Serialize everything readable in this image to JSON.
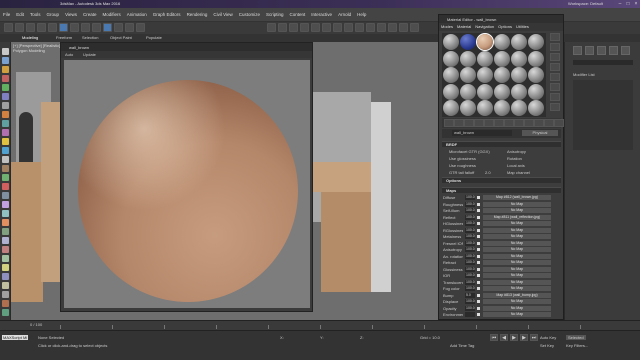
{
  "app": {
    "title": "3dsMax - Autodesk 3ds Max 2016",
    "workspace": "Workspace: Default"
  },
  "menubar": [
    "File",
    "Edit",
    "Tools",
    "Group",
    "Views",
    "Create",
    "Modifiers",
    "Animation",
    "Graph Editors",
    "Rendering",
    "Civil View",
    "Customize",
    "Scripting",
    "Content",
    "Interactive",
    "Arnold",
    "Help"
  ],
  "ribbon": {
    "tabs": [
      "Modeling",
      "Freeform",
      "Selection",
      "Object Paint",
      "Populate"
    ],
    "sublabel": "Polygon Modeling"
  },
  "viewport": {
    "label": "[+] [Perspective] [Realistic]"
  },
  "viewport_editor": {
    "title": "wall_brown",
    "auto_label": "Auto",
    "update_label": "Update"
  },
  "material_editor": {
    "title": "Material Editor - wall_brown",
    "menu": [
      "Modes",
      "Material",
      "Navigation",
      "Options",
      "Utilities"
    ],
    "material_name": "wall_brown",
    "material_type": "Physical",
    "sections": {
      "basic": "BRDF",
      "options": "Options",
      "maps": "Maps"
    },
    "brdf_rows": [
      {
        "label": "Microfacet GTR (GGX)",
        "value": "",
        "extra": "Anisotropy"
      },
      {
        "label": "Use glossiness",
        "value": "",
        "extra": "Rotation"
      },
      {
        "label": "Use roughness",
        "value": "",
        "extra": "Local axis"
      },
      {
        "label": "GTR tail falloff",
        "value": "2.0",
        "extra": "Map channel"
      }
    ],
    "maps": [
      {
        "name": "Diffuse",
        "amount": "100.0",
        "map": "Map #812 (wall_brown.jpg)"
      },
      {
        "name": "Roughness",
        "amount": "100.0",
        "map": "No Map"
      },
      {
        "name": "Self-illum",
        "amount": "100.0",
        "map": "No Map"
      },
      {
        "name": "Reflect",
        "amount": "100.0",
        "map": "Map #811 (wall_reflection.jpg)"
      },
      {
        "name": "HGlossiness",
        "amount": "100.0",
        "map": "No Map"
      },
      {
        "name": "RGlossiness",
        "amount": "100.0",
        "map": "No Map"
      },
      {
        "name": "Metalness",
        "amount": "100.0",
        "map": "No Map"
      },
      {
        "name": "Fresnel IOR",
        "amount": "100.0",
        "map": "No Map"
      },
      {
        "name": "Anisotropy",
        "amount": "100.0",
        "map": "No Map"
      },
      {
        "name": "An. rotation",
        "amount": "100.0",
        "map": "No Map"
      },
      {
        "name": "Refract",
        "amount": "100.0",
        "map": "No Map"
      },
      {
        "name": "Glossiness",
        "amount": "100.0",
        "map": "No Map"
      },
      {
        "name": "IOR",
        "amount": "100.0",
        "map": "No Map"
      },
      {
        "name": "Translucent",
        "amount": "100.0",
        "map": "No Map"
      },
      {
        "name": "Fog color",
        "amount": "100.0",
        "map": "No Map"
      },
      {
        "name": "Bump",
        "amount": "5.0",
        "map": "Map #813 (wall_bump.jpg)"
      },
      {
        "name": "Displace",
        "amount": "100.0",
        "map": "No Map"
      },
      {
        "name": "Opacity",
        "amount": "100.0",
        "map": "No Map"
      },
      {
        "name": "Environment",
        "amount": "",
        "map": "No Map"
      }
    ]
  },
  "command_panel": {
    "modifier_list": "Modifier List"
  },
  "timeline": {
    "frame": "0 / 100",
    "ticks": [
      "0",
      "10",
      "20",
      "30",
      "40",
      "50",
      "60",
      "70",
      "80",
      "90",
      "100"
    ]
  },
  "statusbar": {
    "maxscript": "MAXScript Mi",
    "selection": "None Selected",
    "prompt": "Click or click-and-drag to select objects",
    "x_label": "X:",
    "y_label": "Y:",
    "z_label": "Z:",
    "grid": "Grid = 10.0",
    "add_time_tag": "Add Time Tag",
    "auto_key": "Auto Key",
    "selected": "Selected",
    "set_key": "Set Key",
    "key_filters": "Key Filters..."
  },
  "colors": {
    "accent": "#4a78b0",
    "sphere": "#c79c7e",
    "title_gradient": "#3c2f57"
  }
}
